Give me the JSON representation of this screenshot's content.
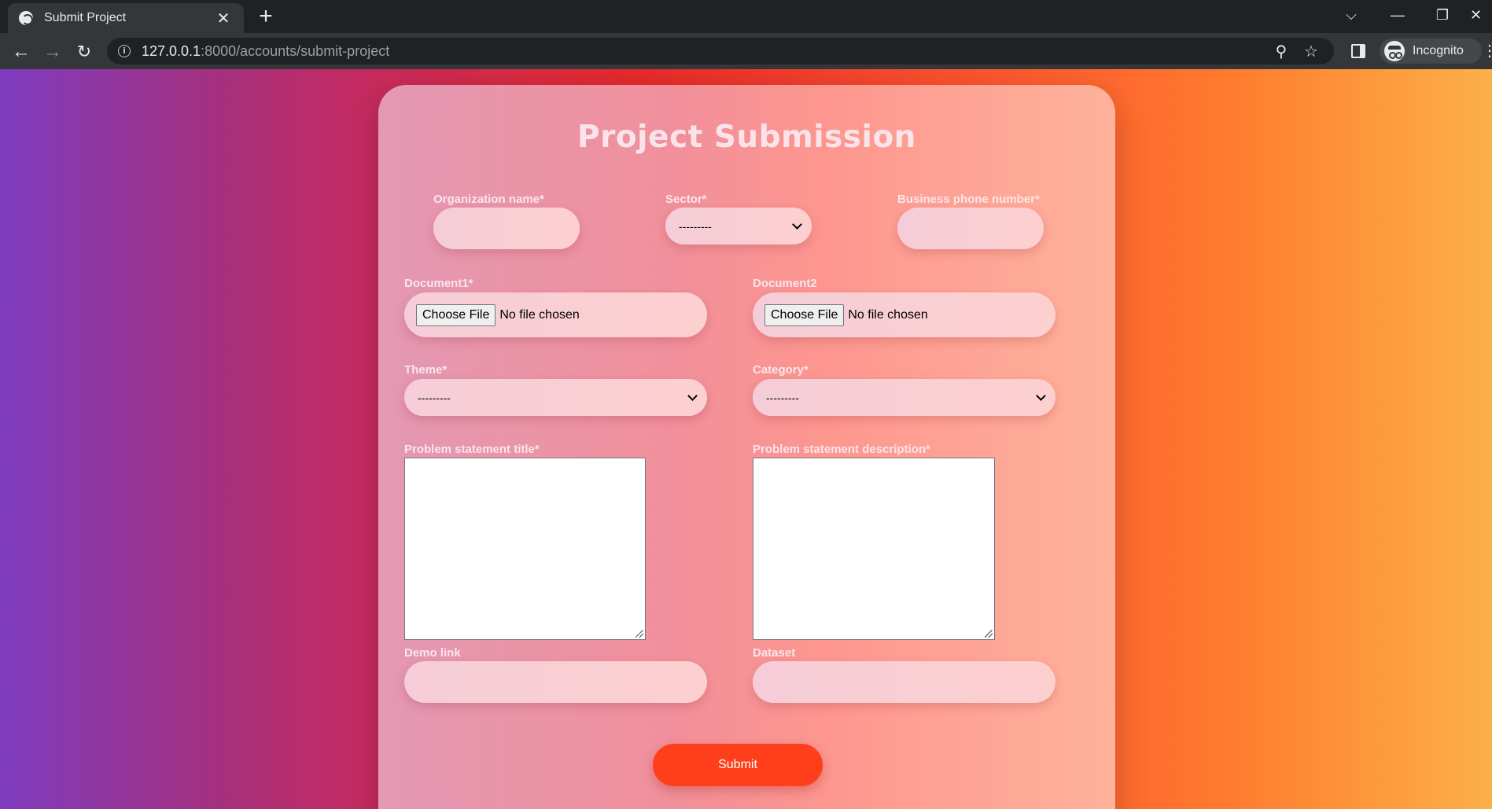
{
  "browser": {
    "tab_title": "Submit Project",
    "tab_close": "✕",
    "new_tab": "+",
    "url_host": "127.0.0.1",
    "url_rest": ":8000/accounts/submit-project",
    "profile_label": "Incognito",
    "window_controls": {
      "tab_search": "⌵",
      "minimize": "—",
      "restore": "❐",
      "close": "✕"
    },
    "icons": [
      "globe-icon",
      "back-arrow-icon",
      "forward-arrow-icon",
      "reload-icon",
      "info-icon",
      "zoom-icon",
      "star-icon",
      "side-panel-icon",
      "incognito-icon",
      "menu-icon"
    ]
  },
  "form": {
    "title": "Project Submission",
    "organization_label": "Organization name*",
    "organization_value": "",
    "sector_label": "Sector*",
    "sector_value": "---------",
    "phone_label": "Business phone number*",
    "phone_value": "",
    "document1_label": "Document1*",
    "document2_label": "Document2",
    "choose_file_label": "Choose File",
    "no_file_text": "No file chosen",
    "theme_label": "Theme*",
    "theme_value": "---------",
    "category_label": "Category*",
    "category_value": "---------",
    "problem_title_label": "Problem statement title*",
    "problem_title_value": "",
    "problem_description_label": "Problem statement description*",
    "problem_description_value": "",
    "demo_link_label": "Demo link",
    "demo_link_value": "",
    "dataset_label": "Dataset",
    "dataset_value": "",
    "submit_label": "Submit"
  },
  "colors": {
    "page_gradient": [
      "#7e3cbf",
      "#c52b61",
      "#e82a2a",
      "#ff5a2f",
      "#fcb048"
    ],
    "submit_button": "#ff3f1c",
    "label_text": "#fbe5ec"
  }
}
